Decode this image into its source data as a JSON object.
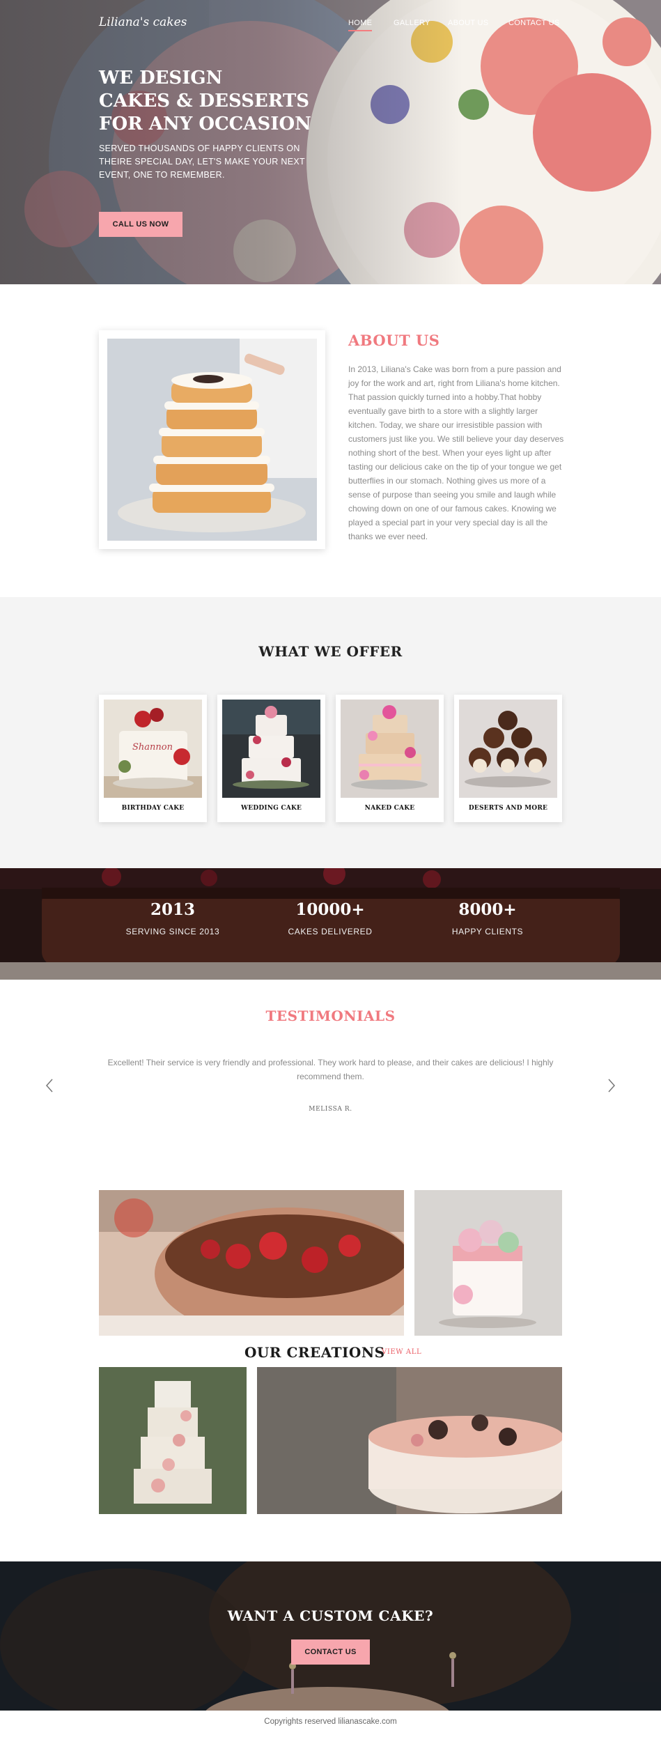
{
  "brand": {
    "logo": "Liliana's cakes",
    "accent": "#f0797f",
    "button_color": "#f7a6ad"
  },
  "nav": {
    "items": [
      {
        "label": "HOME",
        "active": true
      },
      {
        "label": "GALLERY",
        "active": false
      },
      {
        "label": "ABOUT US",
        "active": false
      },
      {
        "label": "CONTACT US",
        "active": false
      }
    ]
  },
  "hero": {
    "title_lines": [
      "WE DESIGN",
      "CAKES & DESSERTS",
      "FOR ANY OCCASION"
    ],
    "subtitle": "SERVED THOUSANDS OF HAPPY CLIENTS ON THEIRE SPECIAL DAY, LET'S MAKE YOUR NEXT EVENT, ONE TO REMEMBER.",
    "button": "CALL US NOW"
  },
  "about": {
    "title": "ABOUT US",
    "text": "In 2013, Liliana's Cake was born from a pure passion and joy for the work and art, right from Liliana's home kitchen. That passion quickly turned into a hobby.That hobby eventually gave birth to a store with a slightly larger kitchen. Today, we share our irresistible passion with customers just like you. We still believe your day deserves nothing short of the best. When your eyes light up after tasting our delicious cake on the tip of your tongue we get butterflies in our stomach. Nothing gives us more of a sense of purpose than seeing you smile and laugh while chowing down on one of our famous cakes. Knowing we played a special part in your very special day is all the thanks we ever need."
  },
  "offer": {
    "title": "WHAT WE OFFER",
    "cards": [
      {
        "label": "BIRTHDAY CAKE",
        "cake_text": "Shannon"
      },
      {
        "label": "WEDDING CAKE"
      },
      {
        "label": "NAKED CAKE"
      },
      {
        "label": "DESERTS AND MORE"
      }
    ]
  },
  "stats": [
    {
      "value": "2013",
      "label": "SERVING SINCE 2013"
    },
    {
      "value": "10000+",
      "label": "CAKES DELIVERED"
    },
    {
      "value": "8000+",
      "label": "HAPPY CLIENTS"
    }
  ],
  "testimonials": {
    "title": "TESTIMONIALS",
    "quote": "Excellent! Their service is very friendly and professional. They work hard to please, and their cakes are delicious! I highly recommend them.",
    "author": "MELISSA R.",
    "prev_icon": "chevron-left-icon",
    "next_icon": "chevron-right-icon"
  },
  "creations": {
    "title": "OUR CREATIONS",
    "view_all": "VIEW ALL"
  },
  "cta": {
    "title": "WANT A CUSTOM CAKE?",
    "button": "CONTACT US"
  },
  "footer": {
    "text": "Copyrights reserved lilianascake.com"
  }
}
